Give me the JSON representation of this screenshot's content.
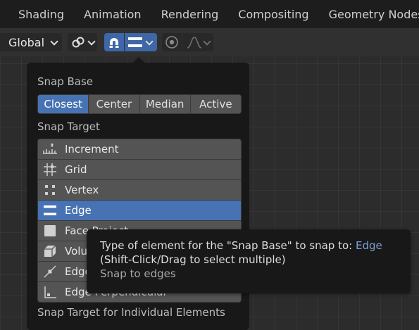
{
  "workspace_tabs": [
    "Shading",
    "Animation",
    "Rendering",
    "Compositing",
    "Geometry Nodes"
  ],
  "header": {
    "orientation_value": "Global",
    "snap_enabled": true
  },
  "snap_popover": {
    "snap_base_label": "Snap Base",
    "snap_base_options": [
      {
        "label": "Closest",
        "active": true
      },
      {
        "label": "Center",
        "active": false
      },
      {
        "label": "Median",
        "active": false
      },
      {
        "label": "Active",
        "active": false
      }
    ],
    "snap_target_label": "Snap Target",
    "snap_targets": [
      {
        "label": "Increment",
        "icon": "increment-icon",
        "active": false
      },
      {
        "label": "Grid",
        "icon": "grid-icon",
        "active": false
      },
      {
        "label": "Vertex",
        "icon": "vertex-icon",
        "active": false
      },
      {
        "label": "Edge",
        "icon": "edge-icon",
        "active": true
      },
      {
        "label": "Face Project",
        "icon": "face-icon",
        "active": false
      },
      {
        "label": "Volume",
        "icon": "volume-icon",
        "active": false
      },
      {
        "label": "Edge Center",
        "icon": "edge-center-icon",
        "active": false
      },
      {
        "label": "Edge Perpendicular",
        "icon": "edge-perpendicular-icon",
        "active": false
      }
    ],
    "individual_label": "Snap Target for Individual Elements"
  },
  "tooltip": {
    "line1_prefix": "Type of element for the \"Snap Base\" to snap to: ",
    "line1_value": "Edge",
    "line2": "(Shift-Click/Drag to select multiple)",
    "line3": "Snap to edges"
  },
  "colors": {
    "accent": "#4772b3",
    "tooltip_highlight": "#7ea1d6",
    "popover_bg": "#181818",
    "viewport_bg": "#2c2c2c"
  }
}
